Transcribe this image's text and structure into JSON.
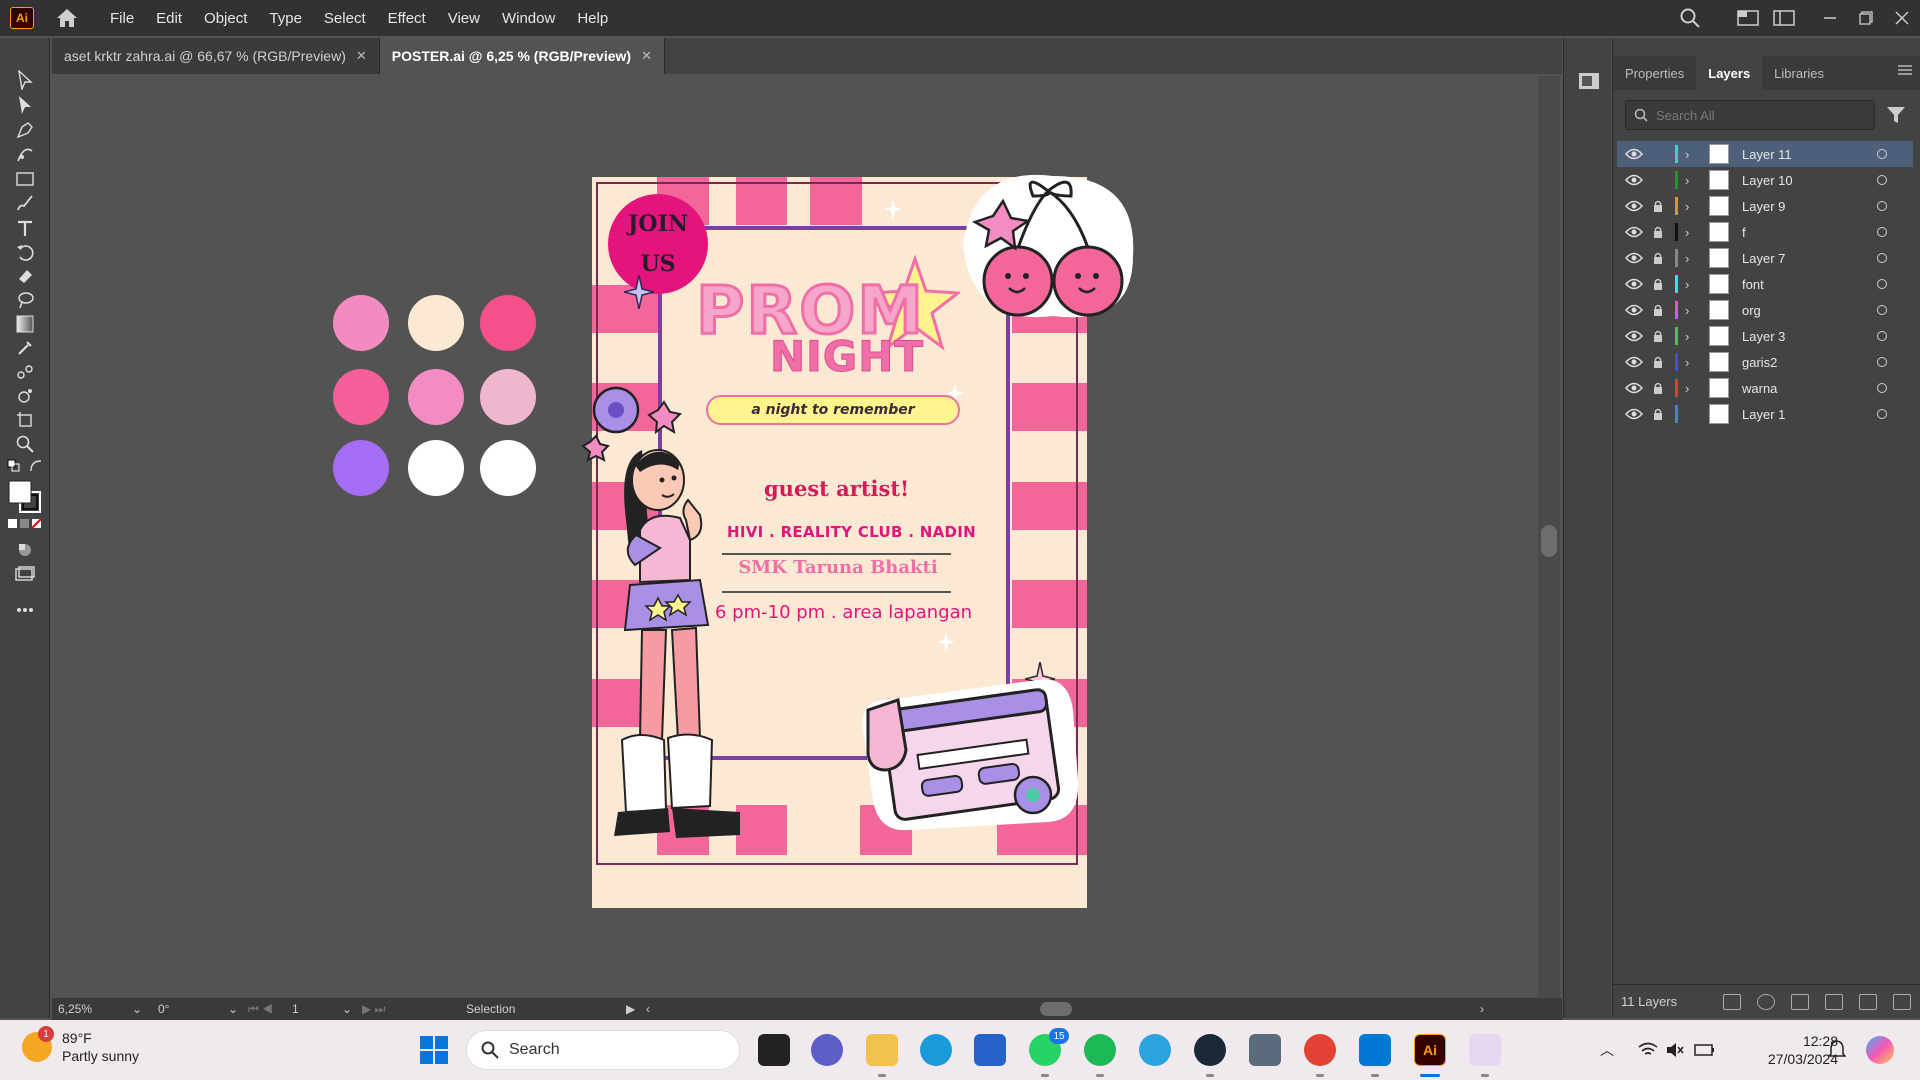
{
  "app": {
    "logo": "Ai",
    "home_icon": "home-icon"
  },
  "menu": [
    "File",
    "Edit",
    "Object",
    "Type",
    "Select",
    "Effect",
    "View",
    "Window",
    "Help"
  ],
  "tabs": [
    {
      "label": "aset krktr zahra.ai @ 66,67 % (RGB/Preview)",
      "close": "✕"
    },
    {
      "label": "POSTER.ai @ 6,25 % (RGB/Preview)",
      "close": "✕"
    }
  ],
  "swatches": [
    "#f28cc0",
    "#fbe9d3",
    "#f5508b",
    "#f5609a",
    "#f48cc4",
    "#efb7cf",
    "#a56cf5",
    "#ffffff",
    "#ffffff"
  ],
  "poster": {
    "join_line1": "JOIN",
    "join_line2": "US",
    "title1": "PROM",
    "title2": "NIGHT",
    "tagline": "a night to remember",
    "guest_heading": "guest artist!",
    "artists": "HIVI . REALITY CLUB . NADIN",
    "school": "SMK Taruna Bhakti",
    "time_place": "6 pm-10 pm . area lapangan",
    "colors": {
      "cream": "#fbe9d3",
      "pink": "#f3669a",
      "magenta": "#e3157c",
      "purple": "#7a3fa0"
    }
  },
  "layers_panel": {
    "tabs": [
      "Properties",
      "Layers",
      "Libraries"
    ],
    "active_tab": "Layers",
    "search_placeholder": "Search All",
    "layers": [
      {
        "name": "Layer 11",
        "color": "#4ec9c9",
        "locked": false,
        "expandable": true,
        "selected": true
      },
      {
        "name": "Layer 10",
        "color": "#2f8f2f",
        "locked": false,
        "expandable": true,
        "selected": false
      },
      {
        "name": "Layer 9",
        "color": "#f28c28",
        "locked": true,
        "expandable": true,
        "selected": false
      },
      {
        "name": "f",
        "color": "#111111",
        "locked": true,
        "expandable": true,
        "selected": false
      },
      {
        "name": "Layer 7",
        "color": "#888888",
        "locked": true,
        "expandable": true,
        "selected": false
      },
      {
        "name": "font",
        "color": "#2ee6e6",
        "locked": true,
        "expandable": true,
        "selected": false
      },
      {
        "name": "org",
        "color": "#e64fe6",
        "locked": true,
        "expandable": true,
        "selected": false
      },
      {
        "name": "Layer 3",
        "color": "#3ad13a",
        "locked": true,
        "expandable": true,
        "selected": false
      },
      {
        "name": "garis2",
        "color": "#4a4ae6",
        "locked": true,
        "expandable": true,
        "selected": false
      },
      {
        "name": "warna",
        "color": "#e63a3a",
        "locked": true,
        "expandable": true,
        "selected": false
      },
      {
        "name": "Layer 1",
        "color": "#4a7be6",
        "locked": true,
        "expandable": false,
        "selected": false
      }
    ],
    "footer_count": "11 Layers"
  },
  "statusbar": {
    "zoom": "6,25%",
    "rotation": "0°",
    "artboard": "1",
    "tool": "Selection"
  },
  "taskbar": {
    "weather_temp": "89°F",
    "weather_desc": "Partly sunny",
    "weather_badge": "1",
    "search_label": "Search",
    "whatsapp_badge": "15",
    "time": "12:28",
    "date": "27/03/2024"
  }
}
